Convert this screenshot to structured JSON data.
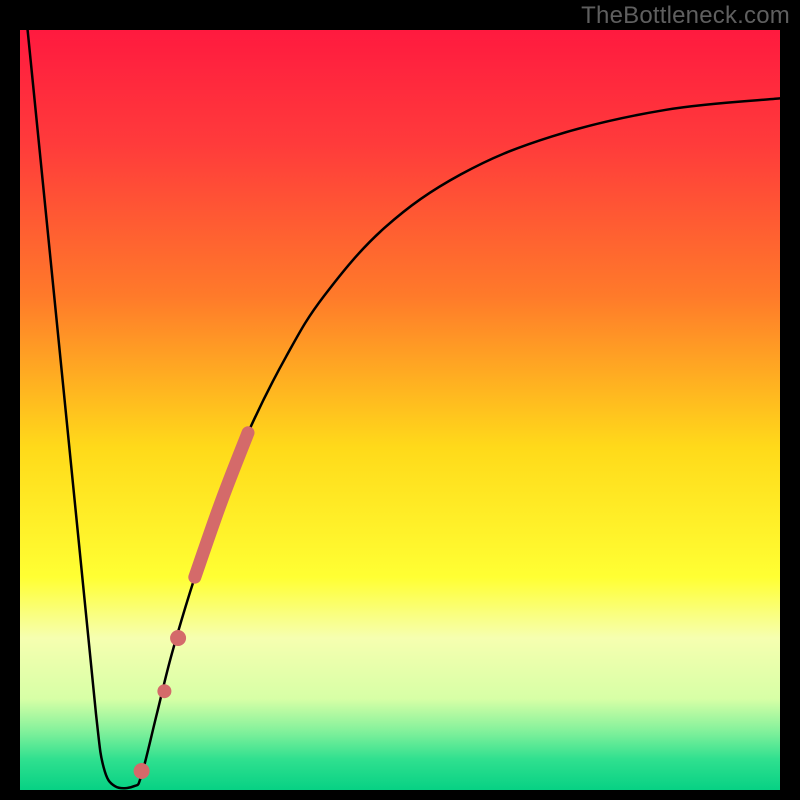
{
  "watermark": "TheBottleneck.com",
  "chart_data": {
    "type": "line",
    "title": "",
    "xlabel": "",
    "ylabel": "",
    "xlim": [
      0,
      100
    ],
    "ylim": [
      0,
      100
    ],
    "grid": false,
    "legend": false,
    "gradient_stops": [
      {
        "offset": 0.0,
        "color": "#ff1a3f"
      },
      {
        "offset": 0.15,
        "color": "#ff3b3b"
      },
      {
        "offset": 0.35,
        "color": "#ff7a2a"
      },
      {
        "offset": 0.55,
        "color": "#ffda1a"
      },
      {
        "offset": 0.72,
        "color": "#ffff33"
      },
      {
        "offset": 0.8,
        "color": "#f6ffb0"
      },
      {
        "offset": 0.88,
        "color": "#d7ffa6"
      },
      {
        "offset": 0.92,
        "color": "#88f29c"
      },
      {
        "offset": 0.96,
        "color": "#2fe08f"
      },
      {
        "offset": 1.0,
        "color": "#07d184"
      }
    ],
    "series": [
      {
        "name": "bottleneck-curve",
        "stroke": "#000000",
        "points": [
          {
            "x": 1.0,
            "y": 100.0
          },
          {
            "x": 3.0,
            "y": 80.0
          },
          {
            "x": 5.5,
            "y": 55.0
          },
          {
            "x": 8.0,
            "y": 30.0
          },
          {
            "x": 10.0,
            "y": 10.0
          },
          {
            "x": 11.0,
            "y": 3.0
          },
          {
            "x": 12.5,
            "y": 0.5
          },
          {
            "x": 15.0,
            "y": 0.5
          },
          {
            "x": 16.0,
            "y": 2.0
          },
          {
            "x": 18.0,
            "y": 10.0
          },
          {
            "x": 20.0,
            "y": 18.0
          },
          {
            "x": 23.0,
            "y": 28.0
          },
          {
            "x": 26.5,
            "y": 38.0
          },
          {
            "x": 30.0,
            "y": 47.0
          },
          {
            "x": 35.0,
            "y": 57.0
          },
          {
            "x": 40.0,
            "y": 65.0
          },
          {
            "x": 48.0,
            "y": 74.0
          },
          {
            "x": 58.0,
            "y": 81.0
          },
          {
            "x": 70.0,
            "y": 86.0
          },
          {
            "x": 85.0,
            "y": 89.5
          },
          {
            "x": 100.0,
            "y": 91.0
          }
        ]
      }
    ],
    "highlight_segments": [
      {
        "name": "highlight-main",
        "stroke": "#d46a6a",
        "width": 13,
        "points": [
          {
            "x": 23.0,
            "y": 28.0
          },
          {
            "x": 26.5,
            "y": 38.0
          },
          {
            "x": 30.0,
            "y": 47.0
          }
        ]
      }
    ],
    "highlight_dots": [
      {
        "x": 20.8,
        "y": 20.0,
        "r": 8,
        "fill": "#d46a6a"
      },
      {
        "x": 19.0,
        "y": 13.0,
        "r": 7,
        "fill": "#d46a6a"
      },
      {
        "x": 16.0,
        "y": 2.5,
        "r": 8,
        "fill": "#d46a6a"
      }
    ]
  }
}
